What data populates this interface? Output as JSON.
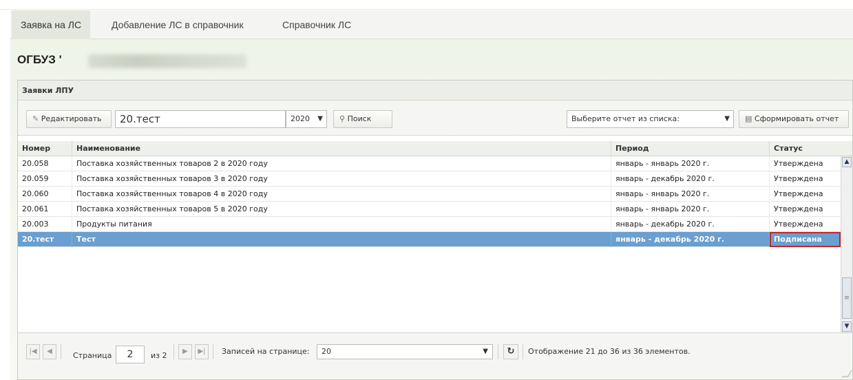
{
  "tabs": [
    {
      "label": "Заявка на ЛС",
      "active": true
    },
    {
      "label": "Добавление ЛС в справочник",
      "active": false
    },
    {
      "label": "Справочник ЛС",
      "active": false
    }
  ],
  "org": {
    "title": "ОГБУЗ '"
  },
  "panel": {
    "title": "Заявки ЛПУ"
  },
  "toolbar": {
    "edit_label": "Редактировать",
    "search_value": "20.тест",
    "year_value": "2020",
    "search_label": "Поиск",
    "report_placeholder": "Выберите отчет из списка:",
    "report_button_label": "Сформировать отчет"
  },
  "grid": {
    "columns": [
      "Номер",
      "Наименование",
      "Период",
      "Статус"
    ],
    "rows": [
      {
        "number": "20.058",
        "name": "Поставка хозяйственных товаров 2 в 2020 году",
        "period": "январь - январь 2020 г.",
        "status": "Утверждена"
      },
      {
        "number": "20.059",
        "name": "Поставка хозяйственных товаров 3 в 2020 году",
        "period": "январь - декабрь 2020 г.",
        "status": "Утверждена"
      },
      {
        "number": "20.060",
        "name": "Поставка хозяйственных товаров 4 в 2020 году",
        "period": "январь - январь 2020 г.",
        "status": "Утверждена"
      },
      {
        "number": "20.061",
        "name": "Поставка хозяйственных товаров 5 в 2020 году",
        "period": "январь - январь 2020 г.",
        "status": "Утверждена"
      },
      {
        "number": "20.003",
        "name": "Продукты питания",
        "period": "январь - декабрь 2020 г.",
        "status": "Утверждена"
      },
      {
        "number": "20.тест",
        "name": "Тест",
        "period": "январь - декабрь 2020 г.",
        "status": "Подписана",
        "selected": true
      }
    ]
  },
  "pager": {
    "page_label": "Страница",
    "current_page": "2",
    "of_label": "из 2",
    "per_page_label": "Записей на странице:",
    "per_page_value": "20",
    "display_text": "Отображение 21 до 36 из 36 элементов."
  },
  "colors": {
    "selected_row": "#6a9fd0",
    "status_highlight": "#c0282d",
    "background": "#eef3e6"
  },
  "icons": [
    "pencil-icon",
    "search-icon",
    "dropdown-chevron-icon",
    "report-icon",
    "first-page-icon",
    "prev-page-icon",
    "next-page-icon",
    "last-page-icon",
    "refresh-icon"
  ]
}
